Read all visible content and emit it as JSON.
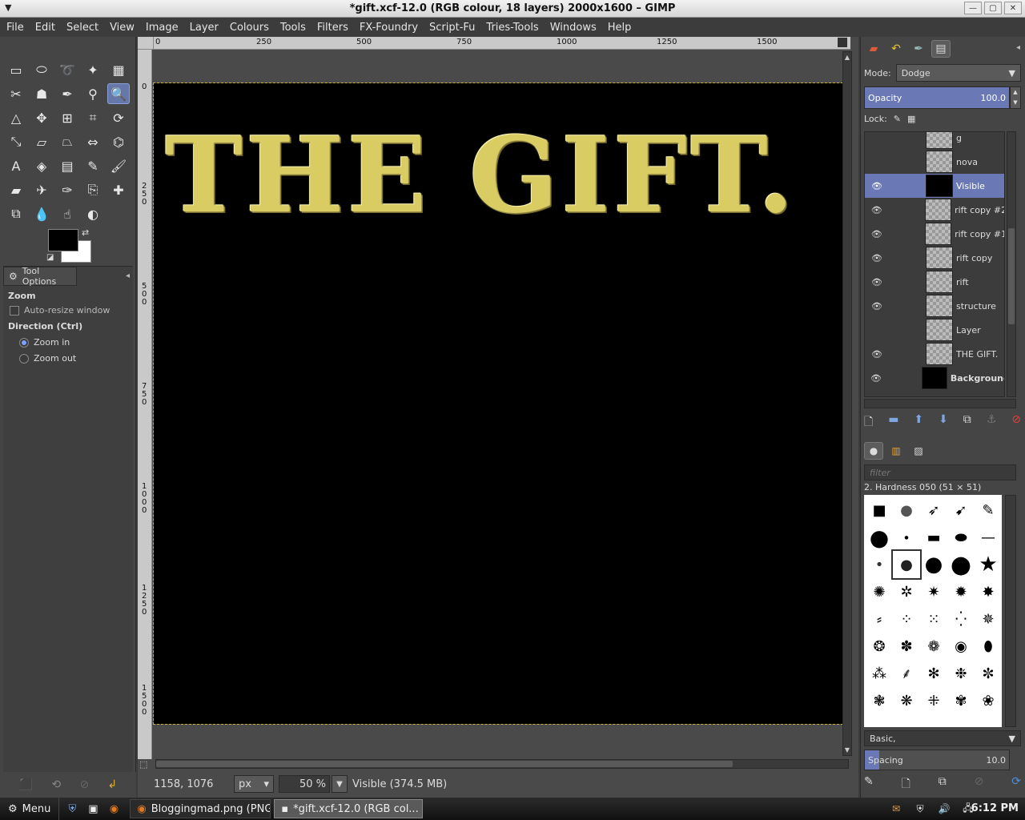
{
  "window": {
    "title": "*gift.xcf-12.0 (RGB colour, 18 layers) 2000x1600 – GIMP"
  },
  "menubar": {
    "items": [
      "File",
      "Edit",
      "Select",
      "View",
      "Image",
      "Layer",
      "Colours",
      "Tools",
      "Filters",
      "FX-Foundry",
      "Script-Fu",
      "Tries-Tools",
      "Windows",
      "Help"
    ]
  },
  "toolbox": {
    "tools": [
      {
        "icon": "rect-select-icon",
        "glyph": "▭"
      },
      {
        "icon": "ellipse-select-icon",
        "glyph": "⬭"
      },
      {
        "icon": "free-select-icon",
        "glyph": "➰"
      },
      {
        "icon": "fuzzy-select-icon",
        "glyph": "✦"
      },
      {
        "icon": "color-select-icon",
        "glyph": "▦"
      },
      {
        "icon": "scissors-select-icon",
        "glyph": "✂"
      },
      {
        "icon": "foreground-select-icon",
        "glyph": "☗"
      },
      {
        "icon": "paths-icon",
        "glyph": "✒"
      },
      {
        "icon": "color-picker-icon",
        "glyph": "⚲"
      },
      {
        "icon": "zoom-icon",
        "glyph": "🔍"
      },
      {
        "icon": "measure-icon",
        "glyph": "△"
      },
      {
        "icon": "move-icon",
        "glyph": "✥"
      },
      {
        "icon": "align-icon",
        "glyph": "⊞"
      },
      {
        "icon": "crop-icon",
        "glyph": "⌗"
      },
      {
        "icon": "rotate-icon",
        "glyph": "⟳"
      },
      {
        "icon": "scale-icon",
        "glyph": "⤡"
      },
      {
        "icon": "shear-icon",
        "glyph": "▱"
      },
      {
        "icon": "perspective-icon",
        "glyph": "⏢"
      },
      {
        "icon": "flip-icon",
        "glyph": "⇔"
      },
      {
        "icon": "cage-icon",
        "glyph": "⌬"
      },
      {
        "icon": "text-icon",
        "glyph": "A"
      },
      {
        "icon": "bucket-fill-icon",
        "glyph": "◈"
      },
      {
        "icon": "blend-icon",
        "glyph": "▤"
      },
      {
        "icon": "pencil-icon",
        "glyph": "✎"
      },
      {
        "icon": "paintbrush-icon",
        "glyph": "🖌"
      },
      {
        "icon": "eraser-icon",
        "glyph": "▰"
      },
      {
        "icon": "airbrush-icon",
        "glyph": "✈"
      },
      {
        "icon": "ink-icon",
        "glyph": "✑"
      },
      {
        "icon": "clone-icon",
        "glyph": "⎘"
      },
      {
        "icon": "heal-icon",
        "glyph": "✚"
      },
      {
        "icon": "perspective-clone-icon",
        "glyph": "⧉"
      },
      {
        "icon": "blur-icon",
        "glyph": "💧"
      },
      {
        "icon": "smudge-icon",
        "glyph": "☝"
      },
      {
        "icon": "dodge-burn-icon",
        "glyph": "◐"
      }
    ],
    "active_tool": "zoom-icon",
    "fg_color": "#000000",
    "bg_color": "#ffffff"
  },
  "tool_options": {
    "tab_label": "Tool Options",
    "tool_name": "Zoom",
    "auto_resize_label": "Auto-resize window",
    "direction_label": "Direction  (Ctrl)",
    "zoom_in_label": "Zoom in",
    "zoom_out_label": "Zoom out",
    "selected_direction": "Zoom in"
  },
  "rulers": {
    "h_ticks": [
      "0",
      "250",
      "500",
      "750",
      "1000",
      "1250",
      "1500"
    ],
    "v_ticks": [
      "0",
      "2\n5\n0",
      "5\n0\n0",
      "7\n5\n0",
      "1\n0\n0\n0",
      "1\n2\n5\n0",
      "1\n5\n0\n0"
    ]
  },
  "canvas": {
    "headline": "THE GIFT.",
    "background_color": "#000000",
    "text_color": "#d9cc63"
  },
  "statusbar": {
    "coords": "1158, 1076",
    "unit": "px",
    "zoom": "50 %",
    "info": "Visible (374.5 MB)"
  },
  "layers_dock": {
    "mode_label": "Mode:",
    "mode_value": "Dodge",
    "opacity_label": "Opacity",
    "opacity_value": "100.0",
    "lock_label": "Lock:",
    "layers": [
      {
        "name": "g",
        "visible": false,
        "selected": false,
        "thumb": "checker"
      },
      {
        "name": "nova",
        "visible": false,
        "selected": false,
        "thumb": "checker"
      },
      {
        "name": "Visible",
        "visible": true,
        "selected": true,
        "thumb": "black"
      },
      {
        "name": "rift copy #2",
        "visible": true,
        "selected": false,
        "thumb": "checker"
      },
      {
        "name": "rift copy #1",
        "visible": true,
        "selected": false,
        "thumb": "checker"
      },
      {
        "name": "rift copy",
        "visible": true,
        "selected": false,
        "thumb": "checker"
      },
      {
        "name": "rift",
        "visible": true,
        "selected": false,
        "thumb": "checker"
      },
      {
        "name": "structure",
        "visible": true,
        "selected": false,
        "thumb": "checker"
      },
      {
        "name": "Layer",
        "visible": false,
        "selected": false,
        "thumb": "checker"
      },
      {
        "name": "THE GIFT.",
        "visible": true,
        "selected": false,
        "thumb": "checker"
      },
      {
        "name": "Background",
        "visible": true,
        "selected": false,
        "thumb": "black"
      }
    ]
  },
  "brushes_dock": {
    "filter_placeholder": "filter",
    "brush_name": "2. Hardness 050 (51 × 51)",
    "preset": "Basic,",
    "spacing_label": "Spacing",
    "spacing_value": "10.0",
    "spacing_fraction": 0.1
  },
  "taskbar": {
    "menu_label": "Menu",
    "tasks": [
      "Bloggingmad.png (PNG I...",
      "*gift.xcf-12.0 (RGB col..."
    ],
    "clock": "6:12 PM"
  }
}
